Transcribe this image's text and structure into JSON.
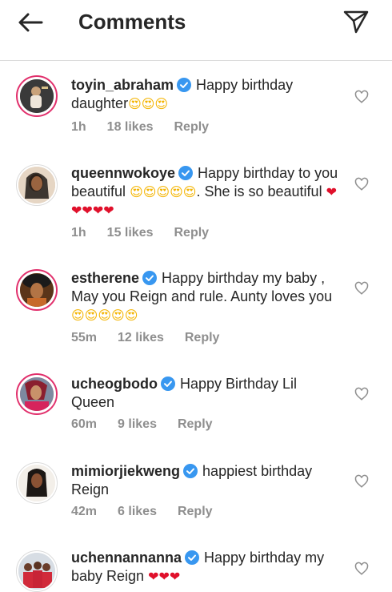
{
  "header": {
    "title": "Comments"
  },
  "comments": [
    {
      "username": "toyin_abraham",
      "text": "Happy birthday daughter",
      "emojis": "😍😍😍",
      "time": "1h",
      "likes": "18 likes",
      "reply": "Reply"
    },
    {
      "username": "queennwokoye",
      "text": "Happy birthday to you beautiful ",
      "emojis": "😍😍😍😍😍",
      "text2": ". She is so beautiful ",
      "emojis2": "❤❤❤❤❤",
      "time": "1h",
      "likes": "15 likes",
      "reply": "Reply"
    },
    {
      "username": "estherene",
      "text": "Happy birthday my baby , May you Reign and rule. Aunty loves you",
      "emojis": "😍😍😍😍😍",
      "time": "55m",
      "likes": "12 likes",
      "reply": "Reply"
    },
    {
      "username": "ucheogbodo",
      "text": "Happy Birthday Lil Queen",
      "time": "60m",
      "likes": "9 likes",
      "reply": "Reply"
    },
    {
      "username": "mimiorjiekweng",
      "text": "happiest birthday Reign",
      "time": "42m",
      "likes": "6 likes",
      "reply": "Reply"
    },
    {
      "username": "uchennannanna",
      "text": "Happy birthday my baby Reign ",
      "emojis": "❤❤❤"
    }
  ]
}
